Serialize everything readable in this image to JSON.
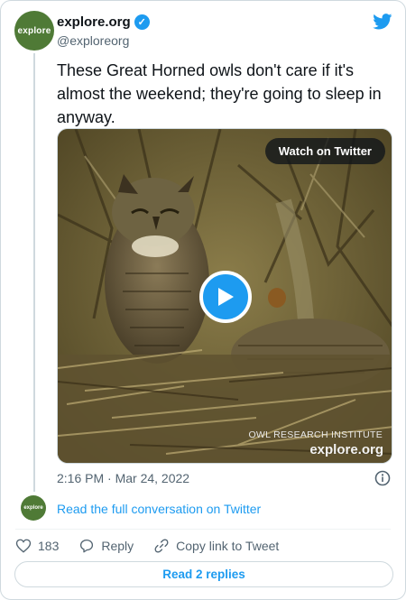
{
  "account": {
    "name": "explore.org",
    "handle": "@exploreorg",
    "avatar_text": "explore"
  },
  "tweet": {
    "text": "These Great Horned owls don't care if it's almost the weekend; they're going to sleep in anyway.",
    "timestamp": "2:16 PM · Mar 24, 2022"
  },
  "media": {
    "watch_label": "Watch on Twitter",
    "overlay_line1": "OWL RESEARCH INSTITUTE",
    "overlay_line2": "explore.org"
  },
  "conversation": {
    "full_conversation_label": "Read the full conversation on Twitter",
    "small_avatar_text": "explore"
  },
  "actions": {
    "like_count": "183",
    "reply_label": "Reply",
    "copy_link_label": "Copy link to Tweet"
  },
  "replies_button_label": "Read 2 replies",
  "colors": {
    "accent": "#1d9bf0",
    "avatar_green": "#4f7a36",
    "secondary_text": "#536471"
  }
}
